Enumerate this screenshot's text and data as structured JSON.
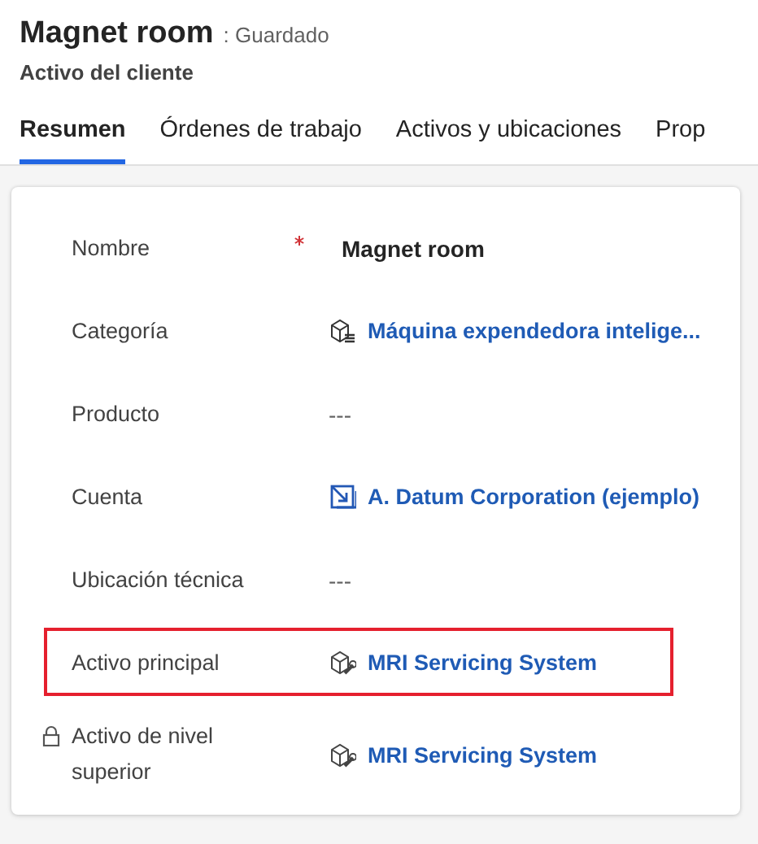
{
  "header": {
    "title": "Magnet room",
    "save_status": ": Guardado",
    "subtitle": "Activo del cliente"
  },
  "tabs": [
    {
      "label": "Resumen",
      "selected": true
    },
    {
      "label": "Órdenes de trabajo",
      "selected": false
    },
    {
      "label": "Activos y ubicaciones",
      "selected": false
    },
    {
      "label": "Prop",
      "selected": false
    }
  ],
  "fields": [
    {
      "label": "Nombre",
      "required": true,
      "locked": false,
      "highlighted": false,
      "kind": "text",
      "value": "Magnet room"
    },
    {
      "label": "Categoría",
      "required": false,
      "locked": false,
      "highlighted": false,
      "kind": "category",
      "value": "Máquina expendedora intelige..."
    },
    {
      "label": "Producto",
      "required": false,
      "locked": false,
      "highlighted": false,
      "kind": "empty",
      "value": "---"
    },
    {
      "label": "Cuenta",
      "required": false,
      "locked": false,
      "highlighted": false,
      "kind": "account",
      "value": "A. Datum Corporation (ejemplo)"
    },
    {
      "label": "Ubicación técnica",
      "required": false,
      "locked": false,
      "highlighted": false,
      "kind": "empty",
      "value": "---"
    },
    {
      "label": "Activo principal",
      "required": false,
      "locked": false,
      "highlighted": true,
      "kind": "asset",
      "value": "MRI Servicing System"
    },
    {
      "label": "Activo de nivel superior",
      "required": false,
      "locked": true,
      "highlighted": false,
      "kind": "asset",
      "value": "MRI Servicing System"
    }
  ]
}
